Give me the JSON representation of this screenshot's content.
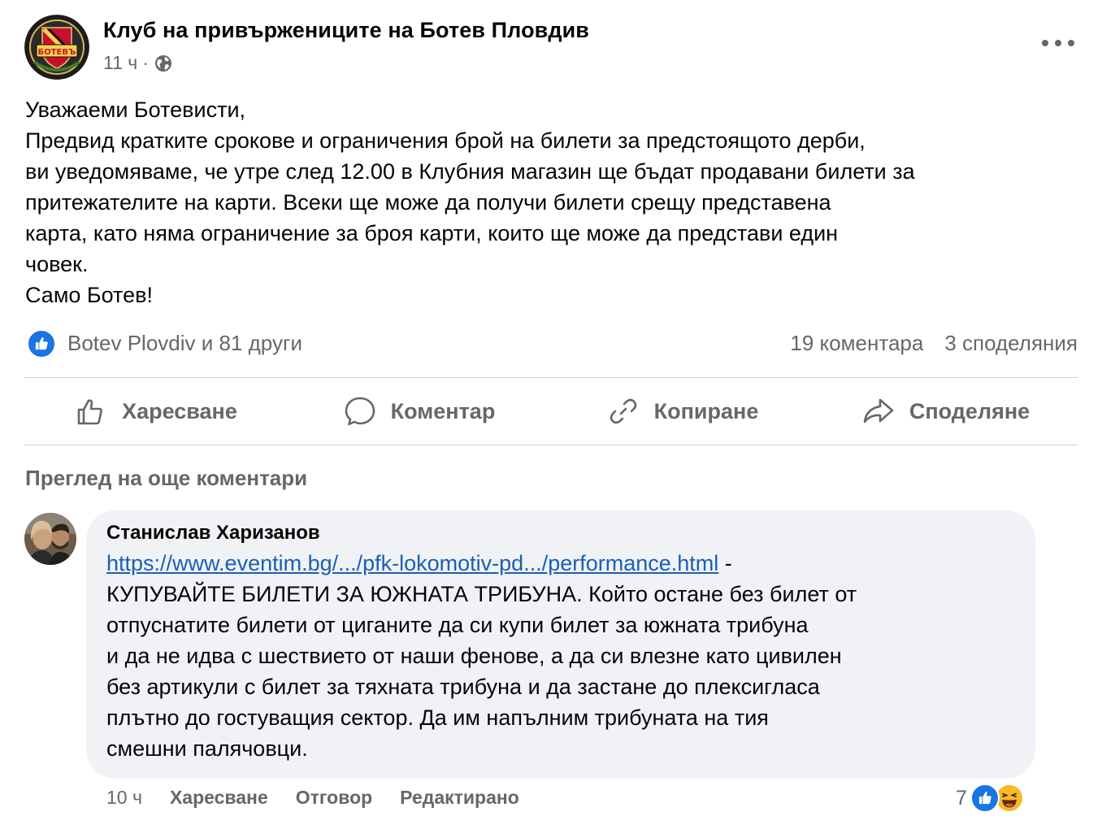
{
  "post": {
    "page_name": "Клуб на привържениците на Ботев Пловдив",
    "time": "11 ч",
    "separator": "·",
    "avatar_text": "БОТЕВЪ",
    "body_lines": [
      "Уважаеми Ботевисти,",
      "Предвид кратките срокове и ограничения брой на билети за предстоящото дерби,",
      "ви уведомяваме, че утре след 12.00 в Клубния магазин ще бъдат продавани билети за",
      "притежателите на карти. Всеки ще може да получи билети срещу представена",
      "карта, като няма ограничение за броя карти, които ще може да представи един",
      "човек.",
      "Само Ботев!"
    ]
  },
  "stats": {
    "reactors": "Botev Plovdiv и 81 други",
    "comments": "19 коментара",
    "shares": "3 споделяния"
  },
  "actions": {
    "like": "Харесване",
    "comment": "Коментар",
    "copy": "Копиране",
    "share": "Споделяне"
  },
  "more_comments": "Преглед на още коментари",
  "comment": {
    "author": "Станислав Харизанов",
    "link": "https://www.eventim.bg/.../pfk-lokomotiv-pd.../performance.html",
    "link_suffix": " -",
    "lines": [
      "КУПУВАЙТЕ БИЛЕТИ ЗА ЮЖНАТА ТРИБУНА. Който остане без билет от",
      "отпуснатите билети от циганите да си купи билет за южната трибуна",
      "и да не идва с шествието от наши фенове, а да си влезне като цивилен",
      "без артикули с билет за тяхната трибуна и да застане до плексигласа",
      "плътно до гостуващия сектор. Да им напълним трибуната на тия",
      "смешни палячовци."
    ],
    "time": "10 ч",
    "like": "Харесване",
    "reply": "Отговор",
    "edited": "Редактирано",
    "reaction_count": "7"
  },
  "colors": {
    "accent_blue": "#1b74e4",
    "link_blue": "#1a5fb4",
    "muted_text": "#65676b",
    "bubble_bg": "#f0f2f5"
  },
  "icons": [
    "more-options-icon",
    "globe-icon",
    "like-reaction-icon",
    "thumbs-up-icon",
    "comment-icon",
    "link-icon",
    "share-icon",
    "haha-reaction-icon"
  ]
}
